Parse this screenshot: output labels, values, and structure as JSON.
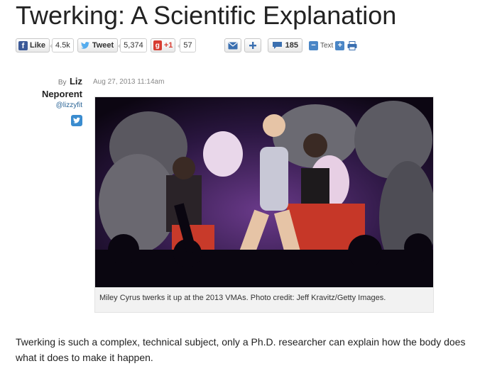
{
  "article": {
    "title": "Twerking: A Scientific Explanation",
    "body": "Twerking is such a complex, technical subject, only a Ph.D. researcher can explain how the body does what it does to make it happen."
  },
  "share": {
    "facebook": {
      "label": "Like",
      "count": "4.5k",
      "icon": "facebook-icon"
    },
    "twitter": {
      "label": "Tweet",
      "count": "5,374",
      "icon": "twitter-bird-icon"
    },
    "google": {
      "label": "+1",
      "count": "57",
      "icon": "google-plus-icon"
    },
    "email": {
      "icon": "envelope-icon"
    },
    "more": {
      "icon": "plus-icon"
    },
    "comments": {
      "count": "185",
      "icon": "speech-bubble-icon"
    },
    "text_size": {
      "label": "Text",
      "decrease_icon": "minus-icon",
      "increase_icon": "plus-icon"
    },
    "print": {
      "icon": "printer-icon"
    }
  },
  "byline": {
    "prefix": "By",
    "author_first": "Liz",
    "author_last": "Neporent",
    "handle": "@lizzyfit",
    "twitter_icon": "twitter-icon",
    "date": "Aug 27, 2013 11:14am"
  },
  "figure": {
    "caption": "Miley Cyrus twerks it up at the 2013 VMAs. Photo credit: Jeff Kravitz/Getty Images."
  },
  "colors": {
    "facebook": "#3b5998",
    "twitter": "#3a8ccf",
    "google": "#d73d32",
    "accent_blue": "#4a86c6"
  }
}
